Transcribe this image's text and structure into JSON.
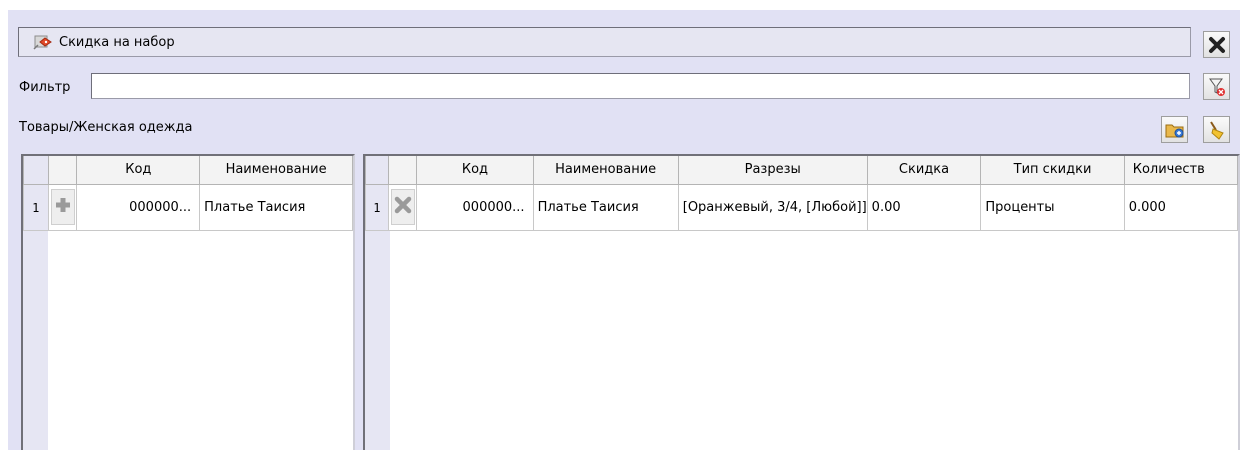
{
  "header": {
    "title": "Скидка на набор",
    "title_icon": "discount-tag-icon",
    "close_icon": "close-x-icon"
  },
  "filter": {
    "label": "Фильтр",
    "value": "",
    "clear_icon": "clear-filter-icon"
  },
  "path": {
    "label": "Товары/Женская одежда",
    "add_folder_icon": "add-folder-icon",
    "clear_icon": "broom-clear-icon"
  },
  "left_grid": {
    "columns": [
      "Код",
      "Наименование"
    ],
    "rows": [
      {
        "num": "1",
        "action_icon": "plus-icon",
        "code": "000000...",
        "name": "Платье Таисия"
      }
    ]
  },
  "right_grid": {
    "columns": [
      "Код",
      "Наименование",
      "Разрезы",
      "Скидка",
      "Тип скидки",
      "Количеств"
    ],
    "rows": [
      {
        "num": "1",
        "action_icon": "remove-x-icon",
        "code": "000000...",
        "name": "Платье Таисия",
        "cuts": "[Оранжевый, 3/4, [Любой]]",
        "discount": "0.00",
        "discount_type": "Проценты",
        "quantity": "0.000"
      }
    ]
  }
}
